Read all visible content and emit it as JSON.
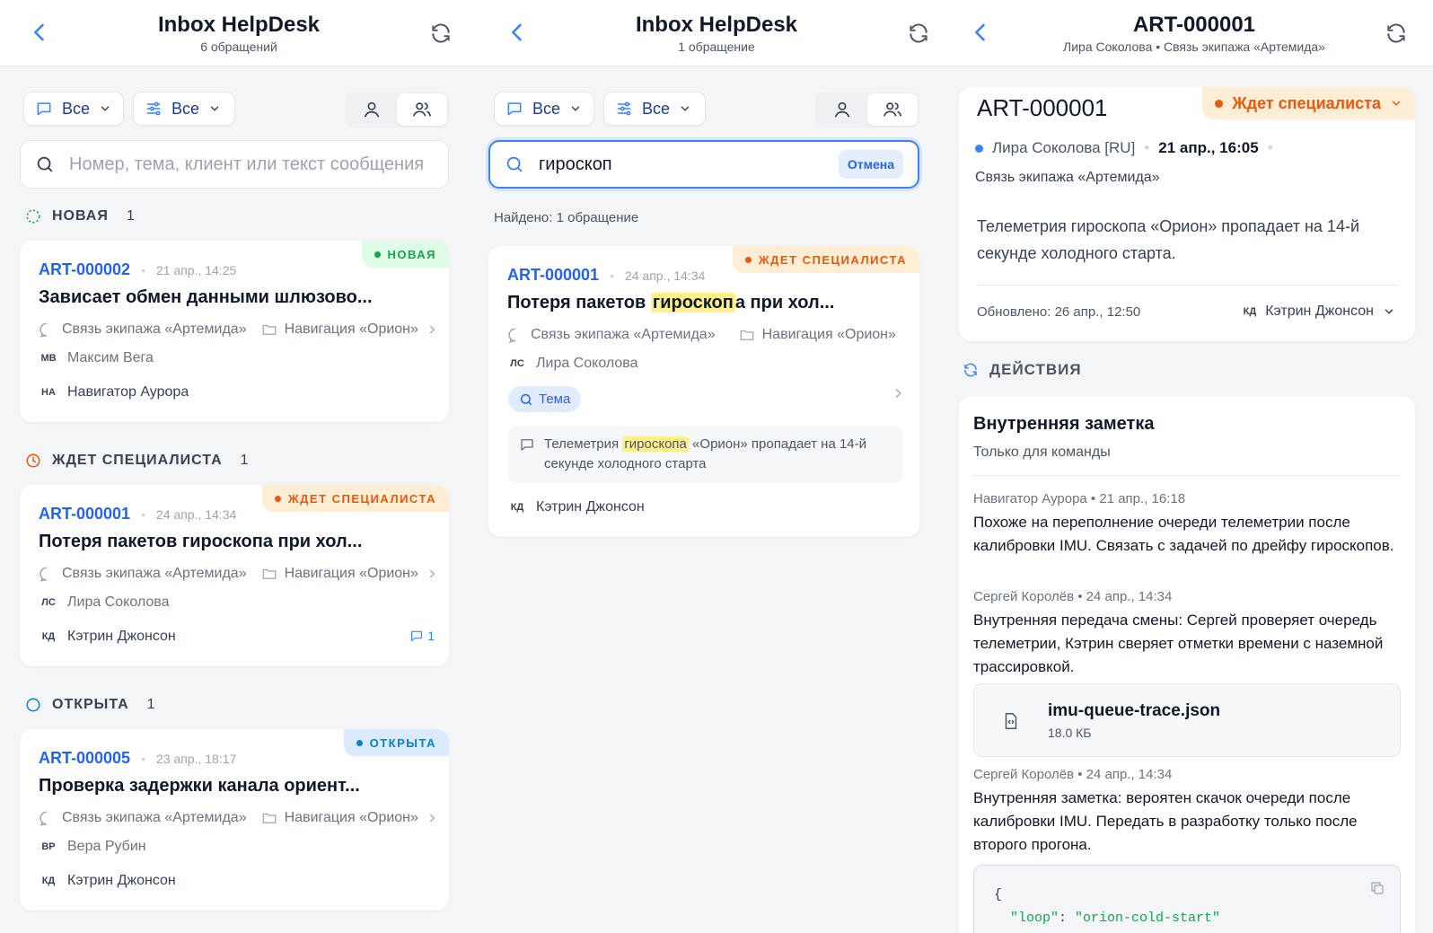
{
  "panel1": {
    "title": "Inbox HelpDesk",
    "subtitle": "6 обращений",
    "filter_type_label": "Все",
    "filter_settings_label": "Все",
    "search_placeholder": "Номер, тема, клиент или текст сообщения",
    "sections": [
      {
        "label": "НОВАЯ",
        "count": "1"
      },
      {
        "label": "ЖДЕТ СПЕЦИАЛИСТА",
        "count": "1"
      },
      {
        "label": "ОТКРЫТА",
        "count": "1"
      }
    ],
    "tickets": [
      {
        "badge": "НОВАЯ",
        "id": "ART-000002",
        "date": "21 апр., 14:25",
        "subject": "Зависает обмен данными шлюзово...",
        "channel": "Связь экипажа «Артемида»",
        "project": "Навигация «Орион»",
        "client_initials": "МВ",
        "client": "Максим Вега",
        "assignee_initials": "НА",
        "assignee": "Навигатор Аурора",
        "comments": ""
      },
      {
        "badge": "ЖДЕТ СПЕЦИАЛИСТА",
        "id": "ART-000001",
        "date": "24 апр., 14:34",
        "subject": "Потеря пакетов гироскопа при хол...",
        "channel": "Связь экипажа «Артемида»",
        "project": "Навигация «Орион»",
        "client_initials": "ЛС",
        "client": "Лира Соколова",
        "assignee_initials": "КД",
        "assignee": "Кэтрин Джонсон",
        "comments": "1"
      },
      {
        "badge": "ОТКРЫТА",
        "id": "ART-000005",
        "date": "23 апр., 18:17",
        "subject": "Проверка задержки канала ориент...",
        "channel": "Связь экипажа «Артемида»",
        "project": "Навигация «Орион»",
        "client_initials": "ВР",
        "client": "Вера Рубин",
        "assignee_initials": "КД",
        "assignee": "Кэтрин Джонсон",
        "comments": ""
      }
    ]
  },
  "panel2": {
    "title": "Inbox HelpDesk",
    "subtitle": "1 обращение",
    "filter_type_label": "Все",
    "filter_settings_label": "Все",
    "search_value": "гироскоп",
    "cancel_label": "Отмена",
    "found": "Найдено: 1 обращение",
    "ticket": {
      "badge": "ЖДЕТ СПЕЦИАЛИСТА",
      "id": "ART-000001",
      "date": "24 апр., 14:34",
      "subject_before": "Потеря пакетов ",
      "subject_match": "гироскоп",
      "subject_after": "а при хол...",
      "channel": "Связь экипажа «Артемида»",
      "project": "Навигация «Орион»",
      "client_initials": "ЛС",
      "client": "Лира Соколова",
      "tag": "Тема",
      "snippet_before": "Телеметрия ",
      "snippet_match": "гироскопа",
      "snippet_after": " «Орион» пропадает на 14-й секунде холодного старта",
      "assignee_initials": "КД",
      "assignee": "Кэтрин Джонсон"
    }
  },
  "panel3": {
    "title": "ART-000001",
    "subtitle": "Лира Соколова • Связь экипажа «Артемида»",
    "detail": {
      "id": "ART-000001",
      "status": "Ждет специалиста",
      "client": "Лира Соколова [RU]",
      "date": "21 апр., 16:05",
      "channel": "Связь экипажа «Артемида»",
      "text": "Телеметрия гироскопа «Орион» пропадает на 14-й секунде холодного старта.",
      "updated": "Обновлено: 26 апр., 12:50",
      "assignee_initials": "КД",
      "assignee": "Кэтрин Джонсон"
    },
    "actions_label": "ДЕЙСТВИЯ",
    "note": {
      "title": "Внутренняя заметка",
      "subtitle": "Только для команды",
      "entries": [
        {
          "author": "Навигатор Аурора • 21 апр., 16:18",
          "text": "Похоже на переполнение очереди телеметрии после калибровки IMU. Связать с задачей по дрейфу гироскопов."
        },
        {
          "author": "Сергей Королёв • 24 апр., 14:34",
          "text": "Внутренняя передача смены: Сергей проверяет очередь телеметрии, Кэтрин сверяет отметки времени с наземной трассировкой."
        },
        {
          "author": "Сергей Королёв • 24 апр., 14:34",
          "text": "Внутренняя заметка: вероятен скачок очереди после калибровки IMU. Передать в разработку только после второго прогона."
        }
      ],
      "file_name": "imu-queue-trace.json",
      "file_size": "18.0 КБ",
      "code_line1": "{",
      "code_key": "\"loop\"",
      "code_value": "\"orion-cold-start\""
    }
  },
  "colors": {
    "accent": "#2563eb",
    "new": "#16a34a",
    "waiting": "#ea580c",
    "open": "#0284c7"
  }
}
